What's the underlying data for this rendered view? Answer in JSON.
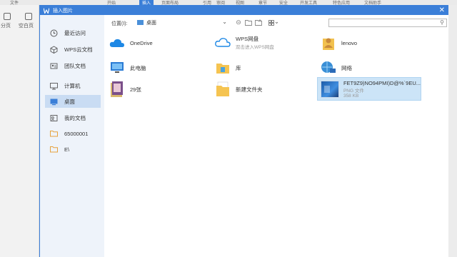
{
  "background_app": {
    "ribbon_tabs": [
      "文件",
      "开始",
      "插入",
      "页面布局",
      "引用",
      "审阅",
      "视图",
      "章节",
      "安全",
      "开发工具",
      "特色应用",
      "文档助手"
    ],
    "active_tab_index": 2,
    "left_tools": [
      "分页",
      "空白页"
    ]
  },
  "dialog": {
    "title": "插入图片",
    "close_label": "✕"
  },
  "sidebar": {
    "items": [
      {
        "label": "最近访问",
        "icon": "clock-icon"
      },
      {
        "label": "WPS云文档",
        "icon": "cube-icon"
      },
      {
        "label": "团队文档",
        "icon": "team-icon"
      },
      {
        "label": "计算机",
        "icon": "monitor-icon"
      },
      {
        "label": "桌面",
        "icon": "desktop-icon",
        "active": true
      },
      {
        "label": "我的文档",
        "icon": "documents-icon"
      },
      {
        "label": "65000001",
        "icon": "folder-icon"
      },
      {
        "label": "E\\",
        "icon": "folder-icon"
      }
    ]
  },
  "toolbar": {
    "location_label": "位置(I):",
    "location_value": "桌面",
    "search_placeholder": ""
  },
  "files": [
    {
      "name": "OneDrive",
      "sub": "",
      "icon": "onedrive-icon"
    },
    {
      "name": "WPS网盘",
      "sub": "双击进入WPS网盘",
      "icon": "wps-cloud-icon"
    },
    {
      "name": "lenovo",
      "sub": "",
      "icon": "user-folder-icon"
    },
    {
      "name": "此电脑",
      "sub": "",
      "icon": "this-pc-icon"
    },
    {
      "name": "库",
      "sub": "",
      "icon": "library-icon"
    },
    {
      "name": "网络",
      "sub": "",
      "icon": "network-icon"
    },
    {
      "name": "29张",
      "sub": "",
      "icon": "image-folder-icon"
    },
    {
      "name": "新建文件夹",
      "sub": "",
      "icon": "new-folder-icon"
    },
    {
      "name": "FET9Z9)NO94PMI)D@%`9EU...",
      "sub": "PNG 文件",
      "sub2": "358 KB",
      "icon": "png-thumbnail",
      "selected": true
    }
  ],
  "colors": {
    "accent": "#3b7fd8",
    "sidebar_bg": "#eef3fa",
    "selected_bg": "#cce4f7"
  }
}
